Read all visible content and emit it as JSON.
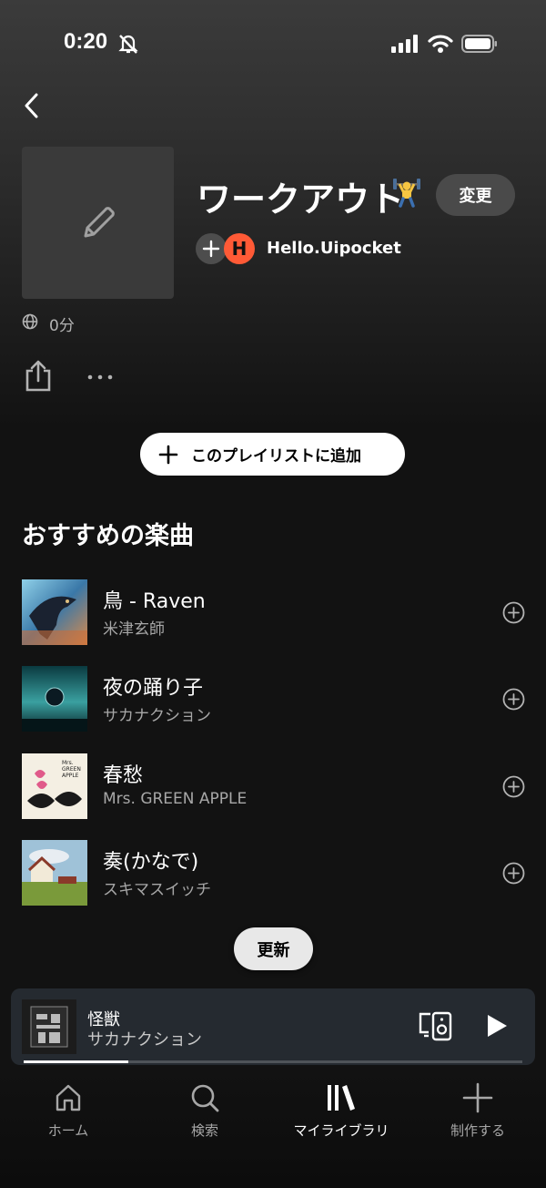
{
  "status_bar": {
    "time": "0:20"
  },
  "playlist": {
    "title": "ワークアウト",
    "edit_label": "変更",
    "owner_initial": "H",
    "owner_name": "Hello.Uipocket",
    "duration": "0分",
    "add_button_label": "このプレイリストに追加"
  },
  "recommendations": {
    "section_title": "おすすめの楽曲",
    "tracks": [
      {
        "title": "鳥 - Raven",
        "artist": "米津玄師"
      },
      {
        "title": "夜の踊り子",
        "artist": "サカナクション"
      },
      {
        "title": "春愁",
        "artist": "Mrs. GREEN APPLE"
      },
      {
        "title": "奏(かなで)",
        "artist": "スキマスイッチ"
      }
    ],
    "refresh_label": "更新"
  },
  "now_playing": {
    "title": "怪獣",
    "artist": "サカナクション",
    "progress": 0.21
  },
  "bottom_nav": [
    {
      "label": "ホーム",
      "icon": "home-icon"
    },
    {
      "label": "検索",
      "icon": "search-icon"
    },
    {
      "label": "マイライブラリ",
      "icon": "library-icon",
      "active": true
    },
    {
      "label": "制作する",
      "icon": "plus-icon"
    }
  ],
  "colors": {
    "accent_avatar": "#ff5a36",
    "background": "#121212",
    "mini_player": "#252a30"
  }
}
